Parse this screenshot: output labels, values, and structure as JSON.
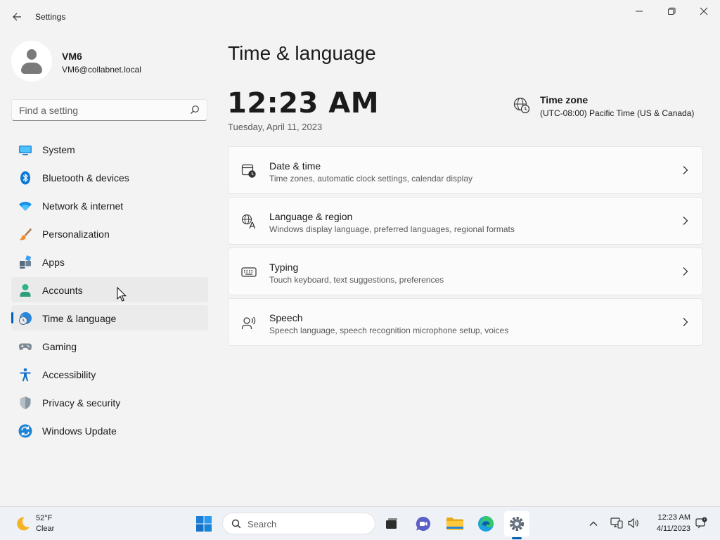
{
  "window": {
    "title": "Settings"
  },
  "profile": {
    "name": "VM6",
    "email": "VM6@collabnet.local"
  },
  "search": {
    "placeholder": "Find a setting"
  },
  "nav": {
    "items": [
      {
        "label": "System",
        "icon": "system-icon"
      },
      {
        "label": "Bluetooth & devices",
        "icon": "bluetooth-icon"
      },
      {
        "label": "Network & internet",
        "icon": "wifi-icon"
      },
      {
        "label": "Personalization",
        "icon": "brush-icon"
      },
      {
        "label": "Apps",
        "icon": "apps-icon"
      },
      {
        "label": "Accounts",
        "icon": "accounts-icon"
      },
      {
        "label": "Time & language",
        "icon": "time-language-icon"
      },
      {
        "label": "Gaming",
        "icon": "gamepad-icon"
      },
      {
        "label": "Accessibility",
        "icon": "accessibility-icon"
      },
      {
        "label": "Privacy & security",
        "icon": "shield-icon"
      },
      {
        "label": "Windows Update",
        "icon": "update-icon"
      }
    ],
    "selected": "Time & language",
    "hovered": "Accounts"
  },
  "main": {
    "title": "Time & language",
    "clock": "12:23 AM",
    "date": "Tuesday, April 11, 2023",
    "timezone": {
      "title": "Time zone",
      "value": "(UTC-08:00) Pacific Time (US & Canada)"
    },
    "cards": [
      {
        "title": "Date & time",
        "desc": "Time zones, automatic clock settings, calendar display",
        "icon": "calendar-clock-icon"
      },
      {
        "title": "Language & region",
        "desc": "Windows display language, preferred languages, regional formats",
        "icon": "language-icon"
      },
      {
        "title": "Typing",
        "desc": "Touch keyboard, text suggestions, preferences",
        "icon": "keyboard-icon"
      },
      {
        "title": "Speech",
        "desc": "Speech language, speech recognition microphone setup, voices",
        "icon": "speech-icon"
      }
    ]
  },
  "taskbar": {
    "weather": {
      "temp": "52°F",
      "condition": "Clear"
    },
    "search_label": "Search",
    "time": "12:23 AM",
    "date": "4/11/2023"
  },
  "colors": {
    "accent": "#005fb8",
    "background": "#f3f3f3",
    "card": "#fbfbfb"
  }
}
